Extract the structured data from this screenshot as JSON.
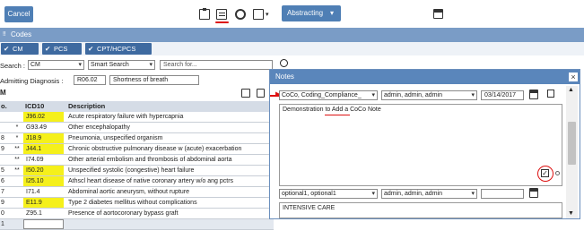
{
  "toolbar": {
    "cancel_label": "Cancel",
    "abstracting_label": "Abstracting",
    "abstracting_caret": "▾"
  },
  "codes_header": {
    "label": "Codes"
  },
  "tabs": [
    {
      "label": "CM"
    },
    {
      "label": "PCS"
    },
    {
      "label": "CPT/HCPCS"
    }
  ],
  "search": {
    "label": "Search :",
    "code_set": "CM",
    "mode": "Smart Search",
    "placeholder": "Search for..."
  },
  "admitting": {
    "label": "Admitting Diagnosis :",
    "code": "R06.02",
    "description": "Shortness of breath"
  },
  "grid": {
    "section_label": "M",
    "col_no": "o.",
    "col_code": "ICD10",
    "col_desc": "Description",
    "rows": [
      {
        "no": "",
        "star": "",
        "code": "J96.02",
        "desc": "Acute respiratory failure with hypercapnia",
        "highlight": true
      },
      {
        "no": "",
        "star": "*",
        "code": "G93.49",
        "desc": "Other encephalopathy",
        "highlight": false
      },
      {
        "no": "",
        "star": "*",
        "code": "J18.9",
        "desc": "Pneumonia, unspecified organism",
        "highlight": true
      },
      {
        "no": "",
        "star": "**",
        "code": "J44.1",
        "desc": "Chronic obstructive pulmonary disease w (acute) exacerbation",
        "highlight": true
      },
      {
        "no": "",
        "star": "**",
        "code": "I74.09",
        "desc": "Other arterial embolism and thrombosis of abdominal aorta",
        "highlight": false
      },
      {
        "no": "",
        "star": "**",
        "code": "I50.20",
        "desc": "Unspecified systolic (congestive) heart failure",
        "highlight": true
      },
      {
        "no": "",
        "star": "",
        "code": "I25.10",
        "desc": "Athscl heart disease of native coronary artery w/o ang pctrs",
        "highlight": true
      },
      {
        "no": "",
        "star": "",
        "code": "I71.4",
        "desc": "Abdominal aortic aneurysm, without rupture",
        "highlight": false
      },
      {
        "no": "",
        "star": "",
        "code": "E11.9",
        "desc": "Type 2 diabetes mellitus without complications",
        "highlight": true
      },
      {
        "no": "0",
        "star": "",
        "code": "Z95.1",
        "desc": "Presence of aortocoronary bypass graft",
        "highlight": false
      },
      {
        "no": "1",
        "star": "",
        "code": "",
        "desc": "",
        "highlight": false
      }
    ],
    "row_numbers": [
      "",
      "",
      "8",
      "9",
      "",
      "5",
      "6",
      "7",
      "9",
      "0",
      "1"
    ]
  },
  "notes": {
    "title": "Notes",
    "close": "×",
    "note1": {
      "category": "CoCo, Coding_Compliance_",
      "user": "admin, admin, admin",
      "date": "03/14/2017",
      "text": "Demonstration to Add a CoCo Note"
    },
    "note2": {
      "category": "optional1, optional1",
      "user": "admin, admin, admin",
      "date": "",
      "text": "INTENSIVE CARE"
    }
  },
  "colors": {
    "toolbar_button": "#4f7fb5",
    "codes_bar": "#7a9cc6",
    "tab": "#3e6aa0",
    "highlight": "#f5f01b",
    "notes_title": "#5a86bb",
    "annotation": "#dd1111"
  }
}
